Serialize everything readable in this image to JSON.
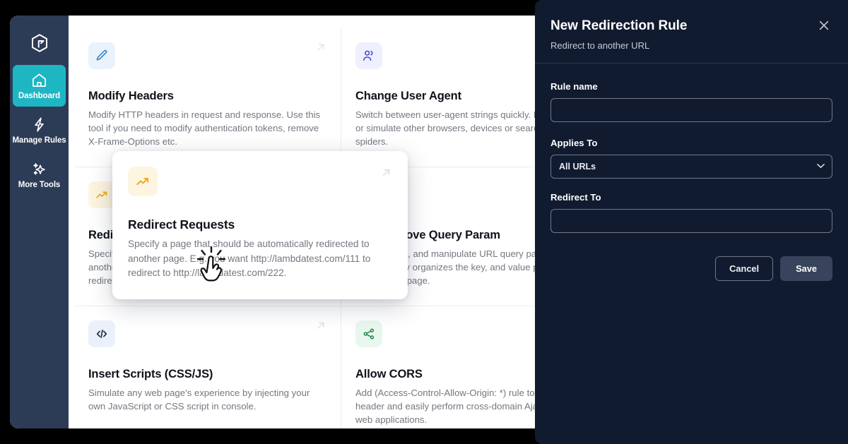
{
  "sidebar": {
    "logo_icon": "hexagon-arrow-logo",
    "items": [
      {
        "label": "Dashboard",
        "icon": "home-icon",
        "active": true
      },
      {
        "label": "Manage Rules",
        "icon": "lightning-bolt-icon",
        "active": false
      },
      {
        "label": "More Tools",
        "icon": "sparkles-icon",
        "active": false
      }
    ]
  },
  "cards": [
    {
      "title": "Modify Headers",
      "desc": "Modify HTTP headers in request and response. Use this tool if you need to modify authentication tokens, remove X-Frame-Options etc.",
      "icon": "pencil-icon",
      "icon_color": "#2a7fc9",
      "icon_bg": "#eaf2fb"
    },
    {
      "title": "Change User Agent",
      "desc": "Switch between user-agent strings quickly. Imitate, spoof or simulate other browsers, devices or search engine spiders.",
      "icon": "users-icon",
      "icon_color": "#4b43d1",
      "icon_bg": "#eef0fd"
    },
    {
      "title": "Redirect Requests",
      "desc": "Specify a page that should be automatically redirected to another page. E.g. you want http://lambdatest.com/111 to redirect to http://lambdatest.com/222.",
      "icon": "trending-up-icon",
      "icon_color": "#f0a81e",
      "icon_bg": "#fdf5df"
    },
    {
      "title": "Add/Remove Query Param",
      "desc": "Add, change, and manipulate URL query parameters. It automatically organizes the key, and value pairs on the current web page.",
      "icon": "question-mark-icon",
      "icon_color": "#2a63c9",
      "icon_bg": "#eaf1fb"
    },
    {
      "title": "Insert Scripts (CSS/JS)",
      "desc": "Simulate any web page's experience by injecting your own JavaScript or CSS script in console.",
      "icon": "code-icon",
      "icon_color": "#1d2b4a",
      "icon_bg": "#eaf1fb"
    },
    {
      "title": "Allow CORS",
      "desc": "Add (Access-Control-Allow-Origin: *) rule to the response header and easily perform cross-domain Ajax requests in web applications.",
      "icon": "share-nodes-icon",
      "icon_color": "#1f8a4c",
      "icon_bg": "#e9f7ee"
    }
  ],
  "hover_card_index": 2,
  "external_link_icon": "arrow-up-right-icon",
  "cursor": {
    "icon": "pointing-hand-click-cursor"
  },
  "panel": {
    "title": "New Redirection Rule",
    "subtitle": "Redirect to another URL",
    "close_icon": "close-icon",
    "fields": {
      "rule_name": {
        "label": "Rule name",
        "value": "",
        "placeholder": ""
      },
      "applies_to": {
        "label": "Applies To",
        "value": "All URLs",
        "options": [
          "All URLs"
        ],
        "chevron_icon": "chevron-down-icon"
      },
      "redirect_to": {
        "label": "Redirect To",
        "value": "",
        "placeholder": ""
      }
    },
    "buttons": {
      "cancel": "Cancel",
      "save": "Save"
    }
  },
  "colors": {
    "sidebar_bg": "#2d3c56",
    "active_nav": "#1fb6c4",
    "panel_bg": "#101b30",
    "save_btn": "#37445c"
  }
}
